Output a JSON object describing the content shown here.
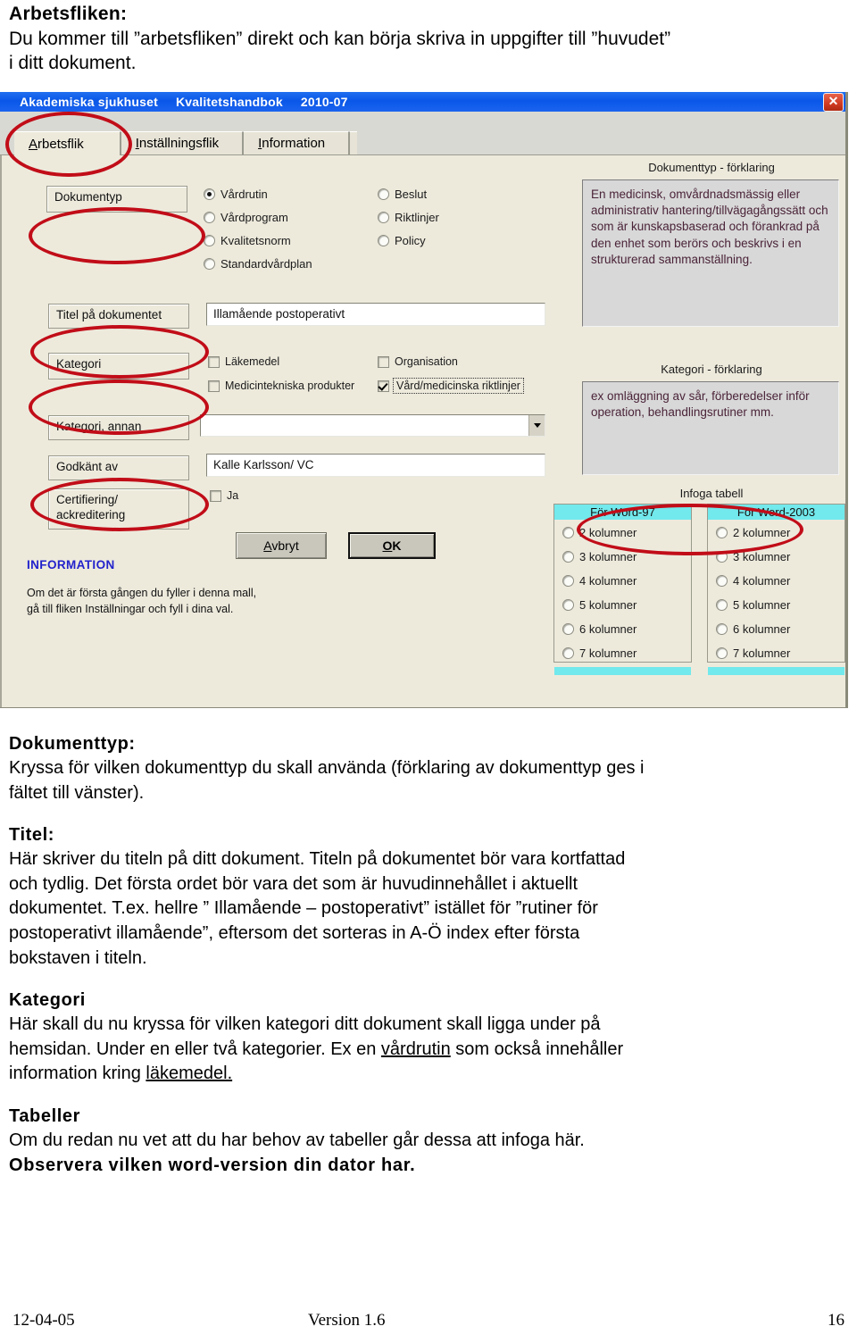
{
  "intro": {
    "heading": "Arbetsfliken:",
    "line1": "Du kommer till ”arbetsfliken” direkt och kan börja skriva in uppgifter till ”huvudet”",
    "line2": "i ditt dokument."
  },
  "app": {
    "titlebar": {
      "org": "Akademiska sjukhuset",
      "name": "Kvalitetshandbok",
      "date": "2010-07",
      "close_label": "✕"
    },
    "tabs": [
      {
        "accel": "A",
        "rest": "rbetsflik",
        "active": true
      },
      {
        "accel": "I",
        "rest": "nställningsflik",
        "active": false
      },
      {
        "accel": "I",
        "rest": "nformation",
        "active": false
      }
    ],
    "labels": {
      "dokumenttyp": "Dokumentyp",
      "titel": "Titel på dokumentet",
      "kategori": "Kategori",
      "kategori_annan": "Kategori, annan",
      "godkant_av": "Godkänt av",
      "certifiering": "Certifiering/\nackreditering"
    },
    "doctype_radios_left": [
      {
        "label": "Vårdrutin",
        "checked": true
      },
      {
        "label": "Vårdprogram",
        "checked": false
      },
      {
        "label": "Kvalitetsnorm",
        "checked": false
      },
      {
        "label": "Standardvårdplan",
        "checked": false
      }
    ],
    "doctype_radios_right": [
      {
        "label": "Beslut",
        "checked": false
      },
      {
        "label": "Riktlinjer",
        "checked": false
      },
      {
        "label": "Policy",
        "checked": false
      }
    ],
    "title_field_value": "Illamående postoperativt",
    "kategori_checks_left": [
      {
        "label": "Läkemedel",
        "checked": false,
        "focused": false
      },
      {
        "label": "Medicintekniska produkter",
        "checked": false,
        "focused": false
      }
    ],
    "kategori_checks_right": [
      {
        "label": "Organisation",
        "checked": false,
        "focused": false
      },
      {
        "label": "Vård/medicinska riktlinjer",
        "checked": true,
        "focused": true
      }
    ],
    "kategori_annan_value": "",
    "godkant_av_value": "Kalle Karlsson/ VC",
    "certifiering_check": {
      "label": "Ja",
      "checked": false
    },
    "buttons": {
      "cancel_accel": "A",
      "cancel_rest": "vbryt",
      "ok_accel": "O",
      "ok_rest": "K"
    },
    "info": {
      "heading": "INFORMATION",
      "line1": "Om det är första gången du fyller i denna mall,",
      "line2": "gå till fliken Inställningar och fyll i dina val."
    },
    "panels": {
      "doctype_caption": "Dokumenttyp - förklaring",
      "doctype_text": "En medicinsk, omvårdnadsmässig eller administrativ hantering/tillvägagångssätt och som är kunskapsbaserad och förankrad på den enhet som berörs och beskrivs i en strukturerad sammanställning.",
      "kategori_caption": "Kategori - förklaring",
      "kategori_text": "ex omläggning av sår, förberedelser inför operation, behandlingsrutiner mm."
    },
    "insert_table": {
      "caption": "Infoga tabell",
      "group_word97": "För Word-97",
      "group_word2003": "För Word-2003",
      "options": [
        "2 kolumner",
        "3 kolumner",
        "4 kolumner",
        "5 kolumner",
        "6 kolumner",
        "7 kolumner"
      ]
    },
    "annotation_color": "#c10d18"
  },
  "body": {
    "sections": [
      {
        "heading": "Dokumenttyp:",
        "paragraphs": [
          "Kryssa för vilken dokumenttyp du skall använda (förklaring av dokumenttyp ges i",
          "fältet till vänster)."
        ]
      },
      {
        "heading": "Titel:",
        "paragraphs": [
          "Här skriver du titeln på ditt dokument. Titeln på dokumentet bör vara kortfattad",
          "och tydlig. Det första ordet bör vara det som är huvudinnehållet i aktuellt",
          "dokumentet. T.ex. hellre ” Illamående – postoperativt” istället för ”rutiner för",
          "postoperativt illamående”, eftersom det sorteras in A-Ö index efter första",
          "bokstaven i titeln."
        ]
      }
    ],
    "kategori_heading": "Kategori",
    "kategori_line1": "Här skall du nu kryssa för vilken kategori ditt dokument skall ligga under på",
    "kategori_line2_a": "hemsidan. Under en eller två kategorier. Ex en ",
    "kategori_line2_u": "vårdrutin",
    "kategori_line2_b": " som också innehåller",
    "kategori_line3_a": "information kring ",
    "kategori_line3_u": "läkemedel.",
    "tabeller_heading": "Tabeller",
    "tabeller_line": "Om du redan nu vet att du har behov av tabeller går dessa att infoga här.",
    "tabeller_strong": "Observera vilken word-version din dator har."
  },
  "footer": {
    "date": "12-04-05",
    "version": "Version 1.6",
    "page": "16"
  }
}
